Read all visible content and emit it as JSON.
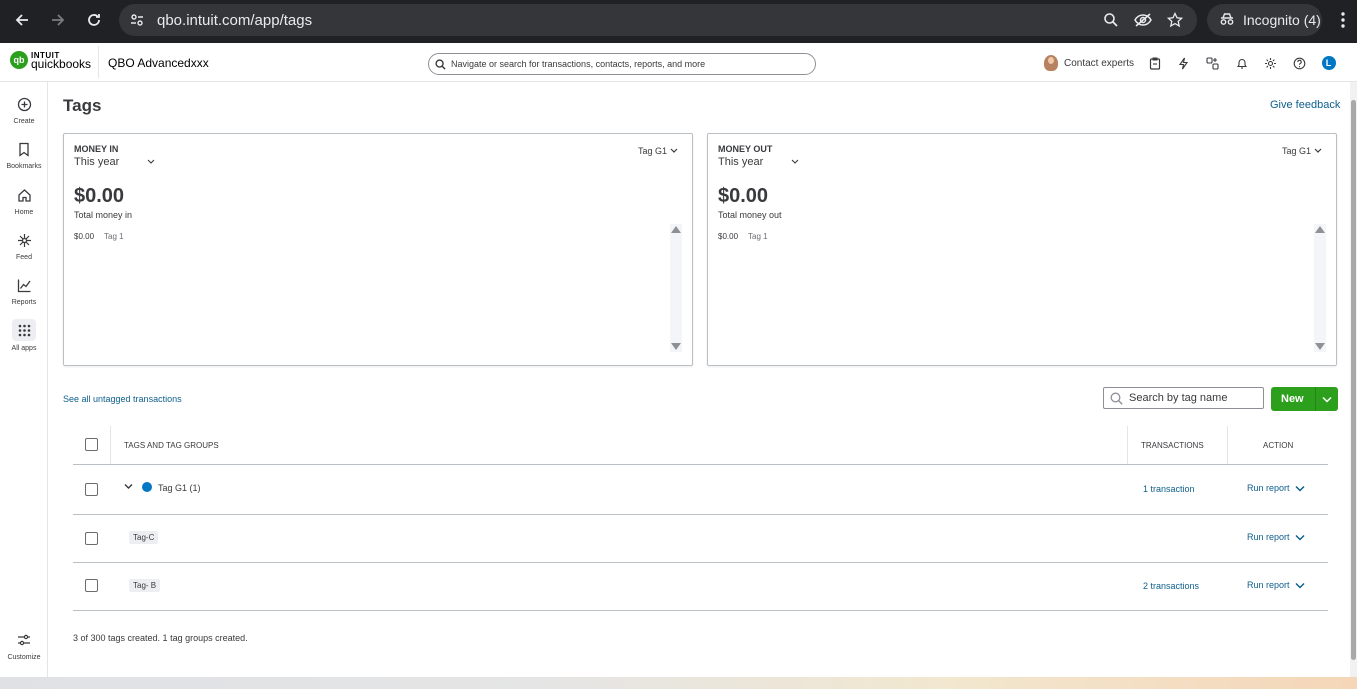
{
  "browser": {
    "url": "qbo.intuit.com/app/tags",
    "incognito_label": "Incognito (4)"
  },
  "header": {
    "logo_line1": "INTUIT",
    "logo_line2": "quickbooks",
    "company_name": "QBO Advancedxxx",
    "search_placeholder": "Navigate or search for transactions, contacts, reports, and more",
    "contact_experts": "Contact experts",
    "user_initial": "L"
  },
  "rail": {
    "items": [
      {
        "label": "Create",
        "icon": "plus-circle-icon"
      },
      {
        "label": "Bookmarks",
        "icon": "bookmark-icon"
      },
      {
        "label": "Home",
        "icon": "home-icon"
      },
      {
        "label": "Feed",
        "icon": "feed-icon"
      },
      {
        "label": "Reports",
        "icon": "reports-icon"
      },
      {
        "label": "All apps",
        "icon": "grid-icon"
      }
    ],
    "customize_label": "Customize"
  },
  "page": {
    "title": "Tags",
    "feedback": "Give feedback"
  },
  "money_in": {
    "label": "MONEY IN",
    "period": "This year",
    "tag_select": "Tag G1",
    "amount": "$0.00",
    "total_label": "Total money in",
    "row_amount": "$0.00",
    "row_tag": "Tag 1"
  },
  "money_out": {
    "label": "MONEY OUT",
    "period": "This year",
    "tag_select": "Tag G1",
    "amount": "$0.00",
    "total_label": "Total money out",
    "row_amount": "$0.00",
    "row_tag": "Tag 1"
  },
  "toolbar": {
    "untagged_link": "See all untagged transactions",
    "search_placeholder": "Search by tag name",
    "new_label": "New"
  },
  "table": {
    "headers": {
      "tags": "TAGS AND TAG GROUPS",
      "transactions": "TRANSACTIONS",
      "action": "ACTION"
    },
    "rows": [
      {
        "name": "Tag G1 (1)",
        "transactions": "1 transaction",
        "action": "Run report",
        "group_color": "#0077c5"
      },
      {
        "name": "Tag-C",
        "transactions": "",
        "action": "Run report"
      },
      {
        "name": "Tag- B",
        "transactions": "2 transactions",
        "action": "Run report"
      }
    ],
    "footer": "3 of 300 tags created. 1 tag groups created."
  }
}
